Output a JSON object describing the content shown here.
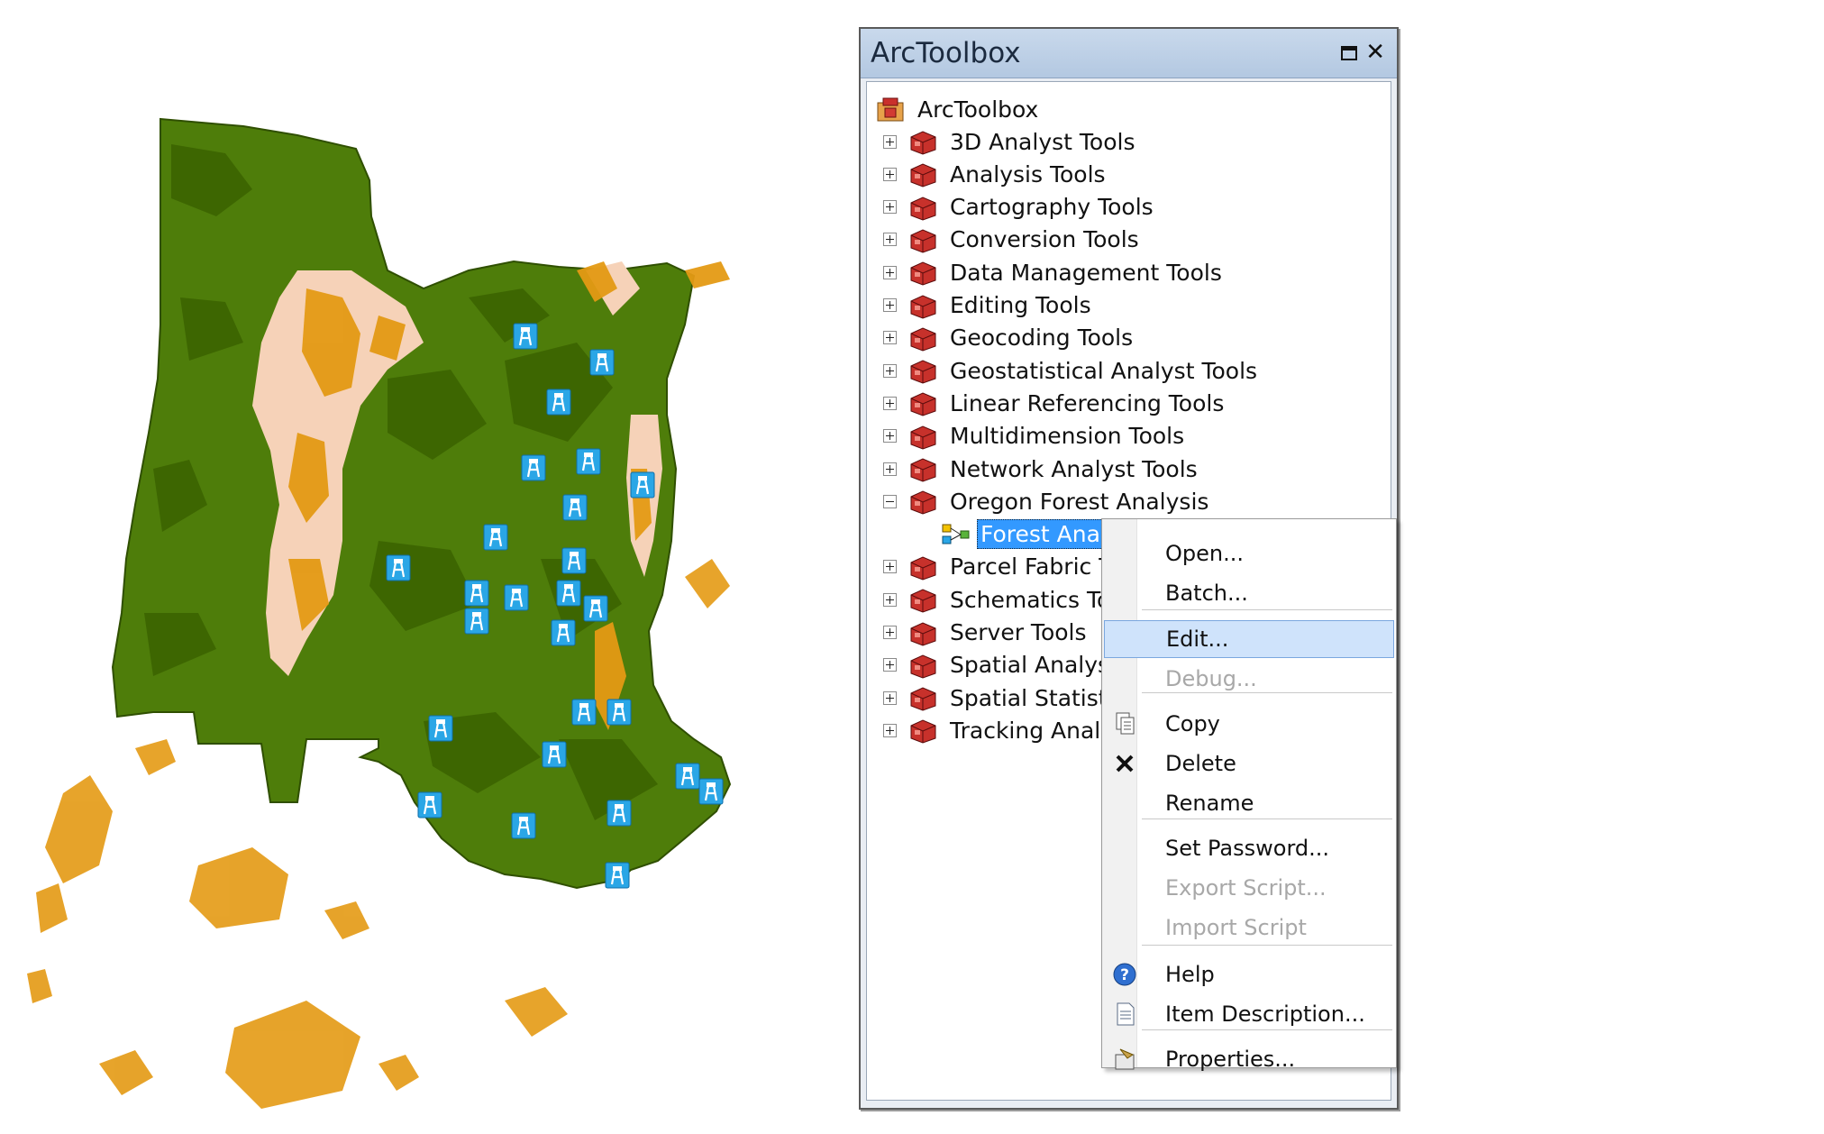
{
  "toolbox": {
    "title": "ArcToolbox",
    "root_label": "ArcToolbox",
    "items": [
      {
        "label": "3D Analyst Tools"
      },
      {
        "label": "Analysis Tools"
      },
      {
        "label": "Cartography Tools"
      },
      {
        "label": "Conversion Tools"
      },
      {
        "label": "Data Management Tools"
      },
      {
        "label": "Editing Tools"
      },
      {
        "label": "Geocoding Tools"
      },
      {
        "label": "Geostatistical Analyst Tools"
      },
      {
        "label": "Linear Referencing Tools"
      },
      {
        "label": "Multidimension Tools"
      },
      {
        "label": "Network Analyst Tools"
      },
      {
        "label": "Oregon Forest Analysis"
      },
      {
        "label": "Forest Analysis",
        "selected": true
      },
      {
        "label": "Parcel Fabric Tools"
      },
      {
        "label": "Schematics Tools"
      },
      {
        "label": "Server Tools"
      },
      {
        "label": "Spatial Analyst Tools"
      },
      {
        "label": "Spatial Statistics Tools"
      },
      {
        "label": "Tracking Analyst Tools"
      }
    ]
  },
  "context_menu": {
    "items": [
      {
        "label": "Open...",
        "state": "enabled"
      },
      {
        "label": "Batch...",
        "state": "enabled"
      },
      {
        "label": "Edit...",
        "state": "highlighted"
      },
      {
        "label": "Debug...",
        "state": "disabled"
      },
      {
        "label": "Copy",
        "icon": "copy-icon",
        "state": "enabled"
      },
      {
        "label": "Delete",
        "icon": "delete-icon",
        "state": "enabled"
      },
      {
        "label": "Rename",
        "state": "enabled"
      },
      {
        "label": "Set Password...",
        "state": "enabled"
      },
      {
        "label": "Export Script...",
        "state": "disabled"
      },
      {
        "label": "Import Script",
        "state": "disabled"
      },
      {
        "label": "Help",
        "icon": "help-icon",
        "state": "enabled"
      },
      {
        "label": "Item Description...",
        "icon": "document-icon",
        "state": "enabled"
      },
      {
        "label": "Properties...",
        "icon": "properties-icon",
        "state": "enabled"
      }
    ]
  },
  "map": {
    "colors": {
      "forest": "#4e7d0a",
      "forest_dark": "#3b6200",
      "open": "#f6d2b8",
      "scrub": "#e49a14",
      "marker": "#2aa6e6"
    },
    "marker_icon": "lookout-tower-icon"
  }
}
